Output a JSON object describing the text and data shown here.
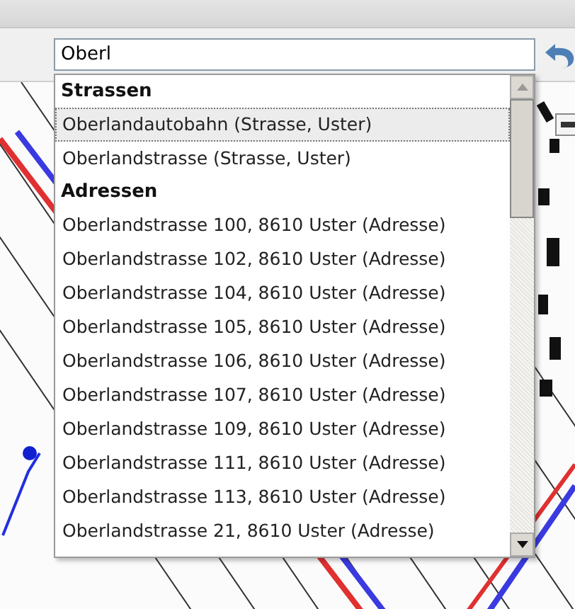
{
  "search": {
    "value": "Oberl"
  },
  "groups": [
    {
      "header": "Strassen",
      "items": [
        {
          "label": "Oberlandautobahn (Strasse, Uster)",
          "selected": true
        },
        {
          "label": "Oberlandstrasse (Strasse, Uster)",
          "selected": false
        }
      ]
    },
    {
      "header": "Adressen",
      "items": [
        {
          "label": "Oberlandstrasse 100, 8610 Uster (Adresse)",
          "selected": false
        },
        {
          "label": "Oberlandstrasse 102, 8610 Uster (Adresse)",
          "selected": false
        },
        {
          "label": "Oberlandstrasse 104, 8610 Uster (Adresse)",
          "selected": false
        },
        {
          "label": "Oberlandstrasse 105, 8610 Uster (Adresse)",
          "selected": false
        },
        {
          "label": "Oberlandstrasse 106, 8610 Uster (Adresse)",
          "selected": false
        },
        {
          "label": "Oberlandstrasse 107, 8610 Uster (Adresse)",
          "selected": false
        },
        {
          "label": "Oberlandstrasse 109, 8610 Uster (Adresse)",
          "selected": false
        },
        {
          "label": "Oberlandstrasse 111, 8610 Uster (Adresse)",
          "selected": false
        },
        {
          "label": "Oberlandstrasse 113, 8610 Uster (Adresse)",
          "selected": false
        },
        {
          "label": "Oberlandstrasse 21, 8610 Uster (Adresse)",
          "selected": false
        }
      ]
    }
  ]
}
